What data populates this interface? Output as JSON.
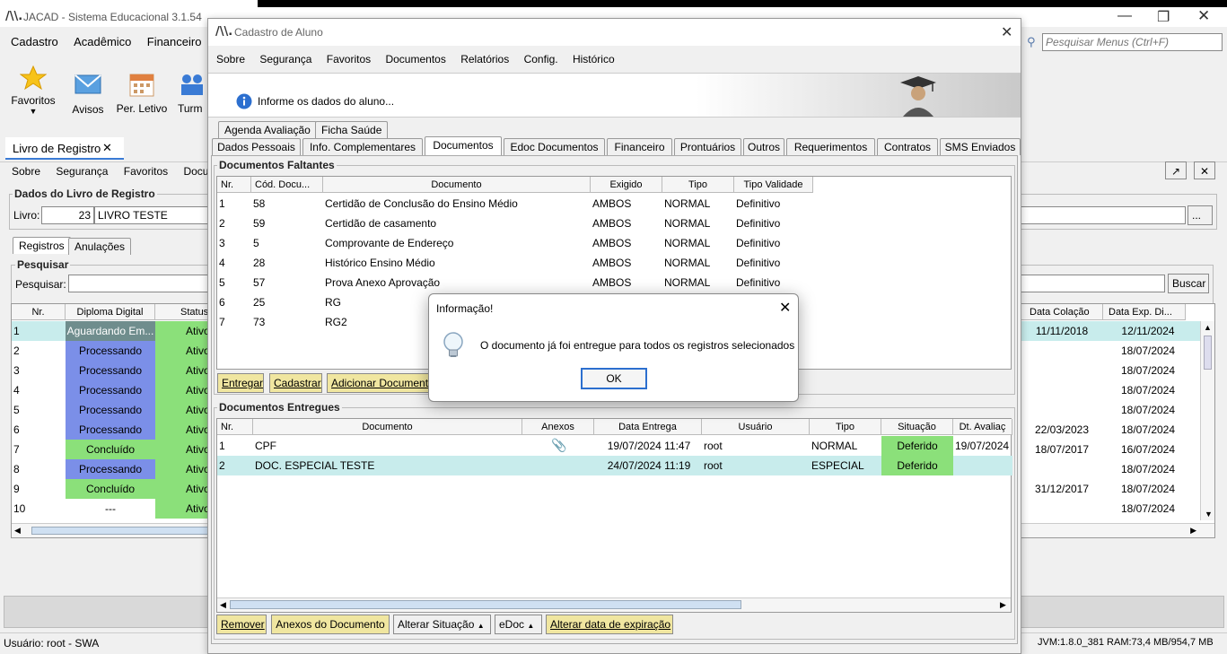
{
  "main": {
    "title": "JACAD - Sistema Educacional 3.1.54",
    "menu": [
      "Cadastro",
      "Acadêmico",
      "Financeiro"
    ],
    "search_placeholder": "Pesquisar Menus (Ctrl+F)",
    "ribbon": [
      {
        "label": "Favoritos",
        "icon": "star-icon"
      },
      {
        "label": "Avisos",
        "icon": "mail-icon"
      },
      {
        "label": "Per. Letivo",
        "icon": "calendar-icon"
      },
      {
        "label": "Turm",
        "icon": "people-icon"
      }
    ],
    "doc_tab": "Livro de Registro",
    "doc_tab_close": "✕",
    "submenu": [
      "Sobre",
      "Segurança",
      "Favoritos",
      "Docum"
    ],
    "dados_legend": "Dados do Livro de Registro",
    "livro_label": "Livro:",
    "livro_num": "23",
    "livro_name": "LIVRO TESTE",
    "ellipsis": "...",
    "tabs": [
      "Registros",
      "Anulações"
    ],
    "pesquisar_legend": "Pesquisar",
    "pesquisar_label": "Pesquisar:",
    "buscar": "Buscar",
    "grid_headers": [
      "Nr.",
      "Diploma Digital",
      "Status"
    ],
    "grid_right_headers": [
      "Data Colação",
      "Data Exp. Di..."
    ],
    "rows": [
      {
        "nr": "1",
        "diploma": "Aguardando Em...",
        "status": "Ativo",
        "colacao": "11/11/2018",
        "exp": "12/11/2024"
      },
      {
        "nr": "2",
        "diploma": "Processando",
        "status": "Ativo",
        "colacao": "",
        "exp": "18/07/2024"
      },
      {
        "nr": "3",
        "diploma": "Processando",
        "status": "Ativo",
        "colacao": "",
        "exp": "18/07/2024"
      },
      {
        "nr": "4",
        "diploma": "Processando",
        "status": "Ativo",
        "colacao": "",
        "exp": "18/07/2024"
      },
      {
        "nr": "5",
        "diploma": "Processando",
        "status": "Ativo",
        "colacao": "",
        "exp": "18/07/2024"
      },
      {
        "nr": "6",
        "diploma": "Processando",
        "status": "Ativo",
        "colacao": "22/03/2023",
        "exp": "18/07/2024"
      },
      {
        "nr": "7",
        "diploma": "Concluído",
        "status": "Ativo",
        "colacao": "18/07/2017",
        "exp": "16/07/2024"
      },
      {
        "nr": "8",
        "diploma": "Processando",
        "status": "Ativo",
        "colacao": "",
        "exp": "18/07/2024"
      },
      {
        "nr": "9",
        "diploma": "Concluído",
        "status": "Ativo",
        "colacao": "31/12/2017",
        "exp": "18/07/2024"
      },
      {
        "nr": "10",
        "diploma": "---",
        "status": "Ativo",
        "colacao": "",
        "exp": "18/07/2024"
      }
    ],
    "status_user": "Usuário: root - SWA",
    "status_jvm": "JVM:1.8.0_381  RAM:73,4 MB/954,7 MB"
  },
  "aluno": {
    "title": "Cadastro de Aluno",
    "menu": [
      "Sobre",
      "Segurança",
      "Favoritos",
      "Documentos",
      "Relatórios",
      "Config.",
      "Histórico"
    ],
    "info": "Informe os dados do aluno...",
    "tabs_row1": [
      "Agenda Avaliação",
      "Ficha Saúde"
    ],
    "tabs_row2": [
      "Dados Pessoais",
      "Info. Complementares",
      "Documentos",
      "Edoc Documentos",
      "Financeiro",
      "Prontuários",
      "Outros",
      "Requerimentos",
      "Contratos",
      "SMS Enviados"
    ],
    "faltantes": {
      "legend": "Documentos Faltantes",
      "headers": [
        "Nr.",
        "Cód. Docu...",
        "Documento",
        "Exigido",
        "Tipo",
        "Tipo Validade"
      ],
      "rows": [
        [
          "1",
          "58",
          "Certidão de Conclusão do Ensino Médio",
          "AMBOS",
          "NORMAL",
          "Definitivo"
        ],
        [
          "2",
          "59",
          "Certidão de casamento",
          "AMBOS",
          "NORMAL",
          "Definitivo"
        ],
        [
          "3",
          "5",
          "Comprovante de Endereço",
          "AMBOS",
          "NORMAL",
          "Definitivo"
        ],
        [
          "4",
          "28",
          "Histórico Ensino Médio",
          "AMBOS",
          "NORMAL",
          "Definitivo"
        ],
        [
          "5",
          "57",
          "Prova Anexo Aprovação",
          "AMBOS",
          "NORMAL",
          "Definitivo"
        ],
        [
          "6",
          "25",
          "RG",
          "",
          "",
          ""
        ],
        [
          "7",
          "73",
          "RG2",
          "",
          "",
          ""
        ]
      ],
      "buttons": [
        "Entregar",
        "Cadastrar",
        "Adicionar Document"
      ]
    },
    "entregues": {
      "legend": "Documentos Entregues",
      "headers": [
        "Nr.",
        "Documento",
        "Anexos",
        "Data Entrega",
        "Usuário",
        "Tipo",
        "Situação",
        "Dt. Avaliaç"
      ],
      "rows": [
        [
          "1",
          "CPF",
          "paperclip",
          "19/07/2024 11:47",
          "root",
          "NORMAL",
          "Deferido",
          "19/07/2024"
        ],
        [
          "2",
          "DOC. ESPECIAL TESTE",
          "",
          "24/07/2024 11:19",
          "root",
          "ESPECIAL",
          "Deferido",
          ""
        ]
      ],
      "buttons": [
        "Remover",
        "Anexos do Documento",
        "Alterar Situação",
        "eDoc",
        "Alterar data de expiração"
      ]
    }
  },
  "dialog": {
    "title": "Informação!",
    "message": "O documento já foi entregue para todos os registros selecionados",
    "ok": "OK"
  }
}
